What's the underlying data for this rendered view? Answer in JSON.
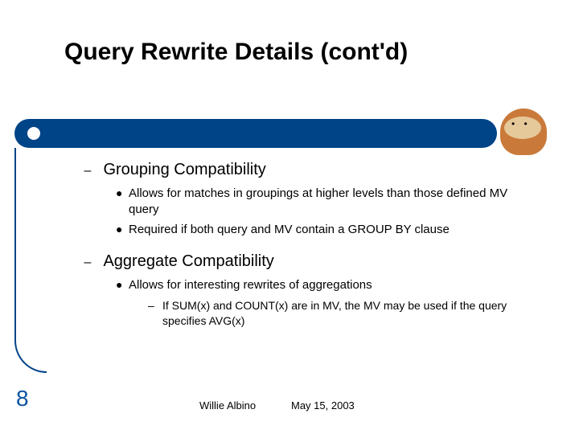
{
  "title": "Query Rewrite Details (cont'd)",
  "sections": [
    {
      "heading": "Grouping Compatibility",
      "bullets": [
        "Allows for matches in groupings at higher levels than those defined MV query",
        "Required if both query and MV contain a GROUP BY clause"
      ]
    },
    {
      "heading": "Aggregate Compatibility",
      "bullets": [
        "Allows for interesting rewrites of aggregations"
      ],
      "subdash": "If SUM(x) and COUNT(x) are in MV, the MV may be used if the query specifies AVG(x)"
    }
  ],
  "slide_number": "8",
  "footer_name": "Willie Albino",
  "footer_date": "May 15, 2003"
}
